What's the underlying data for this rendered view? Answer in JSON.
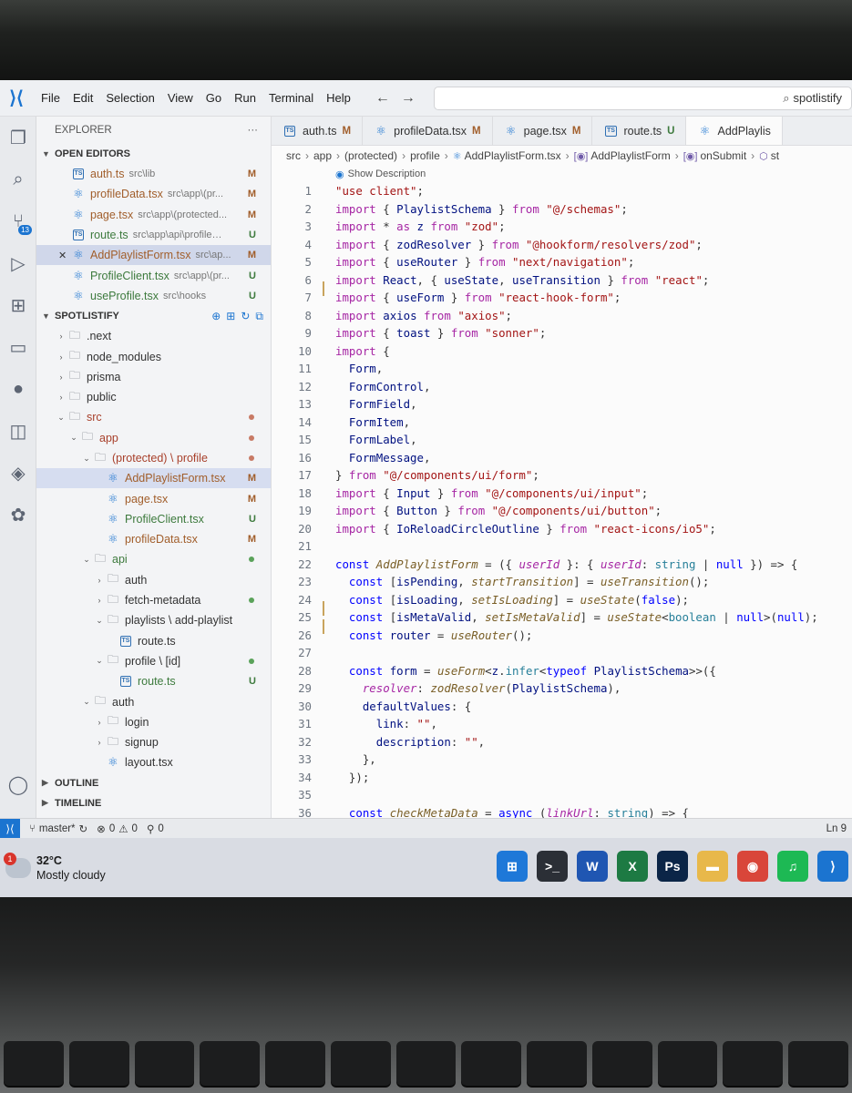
{
  "menu": [
    "File",
    "Edit",
    "Selection",
    "View",
    "Go",
    "Run",
    "Terminal",
    "Help"
  ],
  "search_label": "spotlistify",
  "activity": {
    "scm_badge": "13"
  },
  "explorer": {
    "title": "EXPLORER",
    "more": "···",
    "open_editors_label": "OPEN EDITORS",
    "open_editors": [
      {
        "name": "auth.ts",
        "path": "src\\lib",
        "status": "M",
        "icon": "ts"
      },
      {
        "name": "profileData.tsx",
        "path": "src\\app\\(pr...",
        "status": "M",
        "icon": "react"
      },
      {
        "name": "page.tsx",
        "path": "src\\app\\(protected...",
        "status": "M",
        "icon": "react"
      },
      {
        "name": "route.ts",
        "path": "src\\app\\api\\profile\\[...",
        "status": "U",
        "icon": "ts"
      },
      {
        "name": "AddPlaylistForm.tsx",
        "path": "src\\ap...",
        "status": "M",
        "icon": "react"
      },
      {
        "name": "ProfileClient.tsx",
        "path": "src\\app\\(pr...",
        "status": "U",
        "icon": "react"
      },
      {
        "name": "useProfile.tsx",
        "path": "src\\hooks",
        "status": "U",
        "icon": "react"
      }
    ],
    "project_label": "SPOTLISTIFY",
    "tree": [
      {
        "name": ".next",
        "indent": 1,
        "kind": "folder"
      },
      {
        "name": "node_modules",
        "indent": 1,
        "kind": "folder"
      },
      {
        "name": "prisma",
        "indent": 1,
        "kind": "folder"
      },
      {
        "name": "public",
        "indent": 1,
        "kind": "folder"
      },
      {
        "name": "src",
        "indent": 1,
        "kind": "folder-open",
        "dot": "o",
        "color": "red"
      },
      {
        "name": "app",
        "indent": 2,
        "kind": "folder-open",
        "dot": "o",
        "color": "red"
      },
      {
        "name": "(protected) \\ profile",
        "indent": 3,
        "kind": "folder-open",
        "dot": "o",
        "color": "red"
      },
      {
        "name": "AddPlaylistForm.tsx",
        "indent": 4,
        "kind": "react",
        "status": "M",
        "sel": true
      },
      {
        "name": "page.tsx",
        "indent": 4,
        "kind": "react",
        "status": "M",
        "color": "mod"
      },
      {
        "name": "ProfileClient.tsx",
        "indent": 4,
        "kind": "react",
        "status": "U",
        "color": "untr"
      },
      {
        "name": "profileData.tsx",
        "indent": 4,
        "kind": "react",
        "status": "M",
        "color": "mod"
      },
      {
        "name": "api",
        "indent": 3,
        "kind": "folder-open",
        "dot": "g",
        "color": "untr"
      },
      {
        "name": "auth",
        "indent": 4,
        "kind": "folder"
      },
      {
        "name": "fetch-metadata",
        "indent": 4,
        "kind": "folder",
        "dot": "g"
      },
      {
        "name": "playlists \\ add-playlist",
        "indent": 4,
        "kind": "folder-open"
      },
      {
        "name": "route.ts",
        "indent": 5,
        "kind": "ts"
      },
      {
        "name": "profile \\ [id]",
        "indent": 4,
        "kind": "folder-open",
        "dot": "g"
      },
      {
        "name": "route.ts",
        "indent": 5,
        "kind": "ts",
        "status": "U"
      },
      {
        "name": "auth",
        "indent": 3,
        "kind": "folder-open"
      },
      {
        "name": "login",
        "indent": 4,
        "kind": "folder"
      },
      {
        "name": "signup",
        "indent": 4,
        "kind": "folder"
      },
      {
        "name": "layout.tsx",
        "indent": 4,
        "kind": "react"
      }
    ],
    "outline_label": "OUTLINE",
    "timeline_label": "TIMELINE"
  },
  "tabs": [
    {
      "name": "auth.ts",
      "status": "M",
      "icon": "ts"
    },
    {
      "name": "profileData.tsx",
      "status": "M",
      "icon": "react"
    },
    {
      "name": "page.tsx",
      "status": "M",
      "icon": "react"
    },
    {
      "name": "route.ts",
      "status": "U",
      "icon": "ts"
    },
    {
      "name": "AddPlaylis",
      "status": "",
      "icon": "react",
      "active": true
    }
  ],
  "breadcrumb": [
    "src",
    "app",
    "(protected)",
    "profile",
    "AddPlaylistForm.tsx",
    "AddPlaylistForm",
    "onSubmit",
    "st"
  ],
  "codelens": "Show Description",
  "code": [
    {
      "n": "1",
      "h": "<span class='str'>\"use client\"</span>;"
    },
    {
      "n": "2",
      "h": "<span class='kw2'>import</span> { <span class='var'>PlaylistSchema</span> } <span class='kw2'>from</span> <span class='str'>\"@/schemas\"</span>;"
    },
    {
      "n": "3",
      "h": "<span class='kw2'>import</span> * <span class='kw2'>as</span> <span class='var'>z</span> <span class='kw2'>from</span> <span class='str'>\"zod\"</span>;"
    },
    {
      "n": "4",
      "h": "<span class='kw2'>import</span> { <span class='var'>zodResolver</span> } <span class='kw2'>from</span> <span class='str'>\"@hookform/resolvers/zod\"</span>;"
    },
    {
      "n": "5",
      "h": "<span class='kw2'>import</span> { <span class='var'>useRouter</span> } <span class='kw2'>from</span> <span class='str'>\"next/navigation\"</span>;"
    },
    {
      "n": "6",
      "h": "<span class='kw2'>import</span> <span class='var'>React</span>, { <span class='var'>useState</span>, <span class='var'>useTransition</span> } <span class='kw2'>from</span> <span class='str'>\"react\"</span>;",
      "mark": true
    },
    {
      "n": "7",
      "h": "<span class='kw2'>import</span> { <span class='var'>useForm</span> } <span class='kw2'>from</span> <span class='str'>\"react-hook-form\"</span>;"
    },
    {
      "n": "8",
      "h": "<span class='kw2'>import</span> <span class='var'>axios</span> <span class='kw2'>from</span> <span class='str'>\"axios\"</span>;"
    },
    {
      "n": "9",
      "h": "<span class='kw2'>import</span> { <span class='var'>toast</span> } <span class='kw2'>from</span> <span class='str'>\"sonner\"</span>;"
    },
    {
      "n": "10",
      "h": "<span class='kw2'>import</span> {"
    },
    {
      "n": "11",
      "h": "  <span class='var'>Form</span>,"
    },
    {
      "n": "12",
      "h": "  <span class='var'>FormControl</span>,"
    },
    {
      "n": "13",
      "h": "  <span class='var'>FormField</span>,"
    },
    {
      "n": "14",
      "h": "  <span class='var'>FormItem</span>,"
    },
    {
      "n": "15",
      "h": "  <span class='var'>FormLabel</span>,"
    },
    {
      "n": "16",
      "h": "  <span class='var'>FormMessage</span>,"
    },
    {
      "n": "17",
      "h": "} <span class='kw2'>from</span> <span class='str'>\"@/components/ui/form\"</span>;"
    },
    {
      "n": "18",
      "h": "<span class='kw2'>import</span> { <span class='var'>Input</span> } <span class='kw2'>from</span> <span class='str'>\"@/components/ui/input\"</span>;"
    },
    {
      "n": "19",
      "h": "<span class='kw2'>import</span> { <span class='var'>Button</span> } <span class='kw2'>from</span> <span class='str'>\"@/components/ui/button\"</span>;"
    },
    {
      "n": "20",
      "h": "<span class='kw2'>import</span> { <span class='var'>IoReloadCircleOutline</span> } <span class='kw2'>from</span> <span class='str'>\"react-icons/io5\"</span>;"
    },
    {
      "n": "21",
      "h": ""
    },
    {
      "n": "22",
      "h": "<span class='kw'>const</span> <span class='fn'>AddPlaylistForm</span> = ({ <span class='pr'>userId</span> }: { <span class='pr'>userId</span>: <span class='ty'>string</span> | <span class='kw'>null</span> }) =&gt; {"
    },
    {
      "n": "23",
      "h": "  <span class='kw'>const</span> [<span class='var'>isPending</span>, <span class='fn'>startTransition</span>] = <span class='fn'>useTransition</span>();"
    },
    {
      "n": "24",
      "h": "  <span class='kw'>const</span> [<span class='var'>isLoading</span>, <span class='fn'>setIsLoading</span>] = <span class='fn'>useState</span>(<span class='kw'>false</span>);",
      "mark": true
    },
    {
      "n": "25",
      "h": "  <span class='kw'>const</span> [<span class='var'>isMetaValid</span>, <span class='fn'>setIsMetaValid</span>] = <span class='fn'>useState</span>&lt;<span class='ty'>boolean</span> | <span class='kw'>null</span>&gt;(<span class='kw'>null</span>);",
      "mark": true
    },
    {
      "n": "26",
      "h": "  <span class='kw'>const</span> <span class='var'>router</span> = <span class='fn'>useRouter</span>();"
    },
    {
      "n": "27",
      "h": ""
    },
    {
      "n": "28",
      "h": "  <span class='kw'>const</span> <span class='var'>form</span> = <span class='fn'>useForm</span>&lt;<span class='var'>z</span>.<span class='ty'>infer</span>&lt;<span class='kw'>typeof</span> <span class='var'>PlaylistSchema</span>&gt;&gt;({"
    },
    {
      "n": "29",
      "h": "    <span class='pr'>resolver</span>: <span class='fn'>zodResolver</span>(<span class='var'>PlaylistSchema</span>),"
    },
    {
      "n": "30",
      "h": "    <span class='var'>defaultValues</span>: {"
    },
    {
      "n": "31",
      "h": "      <span class='var'>link</span>: <span class='str'>\"\"</span>,"
    },
    {
      "n": "32",
      "h": "      <span class='var'>description</span>: <span class='str'>\"\"</span>,"
    },
    {
      "n": "33",
      "h": "    },"
    },
    {
      "n": "34",
      "h": "  });"
    },
    {
      "n": "35",
      "h": ""
    },
    {
      "n": "36",
      "h": "  <span class='kw'>const</span> <span class='fn'>checkMetaData</span> = <span class='kw'>async</span> (<span class='pr'>linkUrl</span>: <span class='ty'>string</span>) =&gt; {"
    }
  ],
  "statusbar": {
    "branch": "master*",
    "errors": "0",
    "warnings": "0",
    "ports": "0",
    "position": "Ln 9"
  },
  "taskbar": {
    "temp": "32°C",
    "weather": "Mostly cloudy",
    "badge": "1",
    "apps": [
      {
        "name": "windows-start",
        "label": "⊞",
        "color": "#1e78d8"
      },
      {
        "name": "terminal",
        "label": ">_",
        "color": "#2b2f36"
      },
      {
        "name": "word",
        "label": "W",
        "color": "#1f56b2"
      },
      {
        "name": "excel",
        "label": "X",
        "color": "#1d7a43"
      },
      {
        "name": "photoshop",
        "label": "Ps",
        "color": "#0b2547"
      },
      {
        "name": "file-explorer",
        "label": "▬",
        "color": "#e8b84a"
      },
      {
        "name": "chrome",
        "label": "◉",
        "color": "#d9463a"
      },
      {
        "name": "spotify",
        "label": "♫",
        "color": "#1db954"
      },
      {
        "name": "vscode",
        "label": "⟩",
        "color": "#1b74d0"
      }
    ]
  }
}
